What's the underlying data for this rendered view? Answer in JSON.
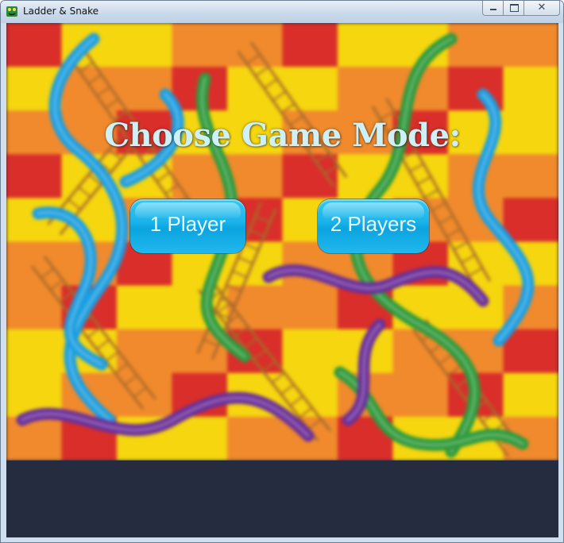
{
  "window": {
    "title": "Ladder & Snake",
    "close_glyph": "✕"
  },
  "menu": {
    "heading": "Choose Game Mode:",
    "buttons": [
      {
        "label": "1 Player"
      },
      {
        "label": "2 Players"
      }
    ]
  },
  "colors": {
    "tile_red": "#d92e2a",
    "tile_orange": "#f08a2c",
    "tile_yellow": "#f5d60f",
    "snake_blue": "#1b9ee0",
    "snake_green": "#2e9a3c",
    "snake_purple": "#6a2f9a",
    "ladder": "#a86a2a",
    "heading_text": "#cdf1f6",
    "button_blue": "#1cb4ea",
    "backdrop": "#262c3f"
  }
}
